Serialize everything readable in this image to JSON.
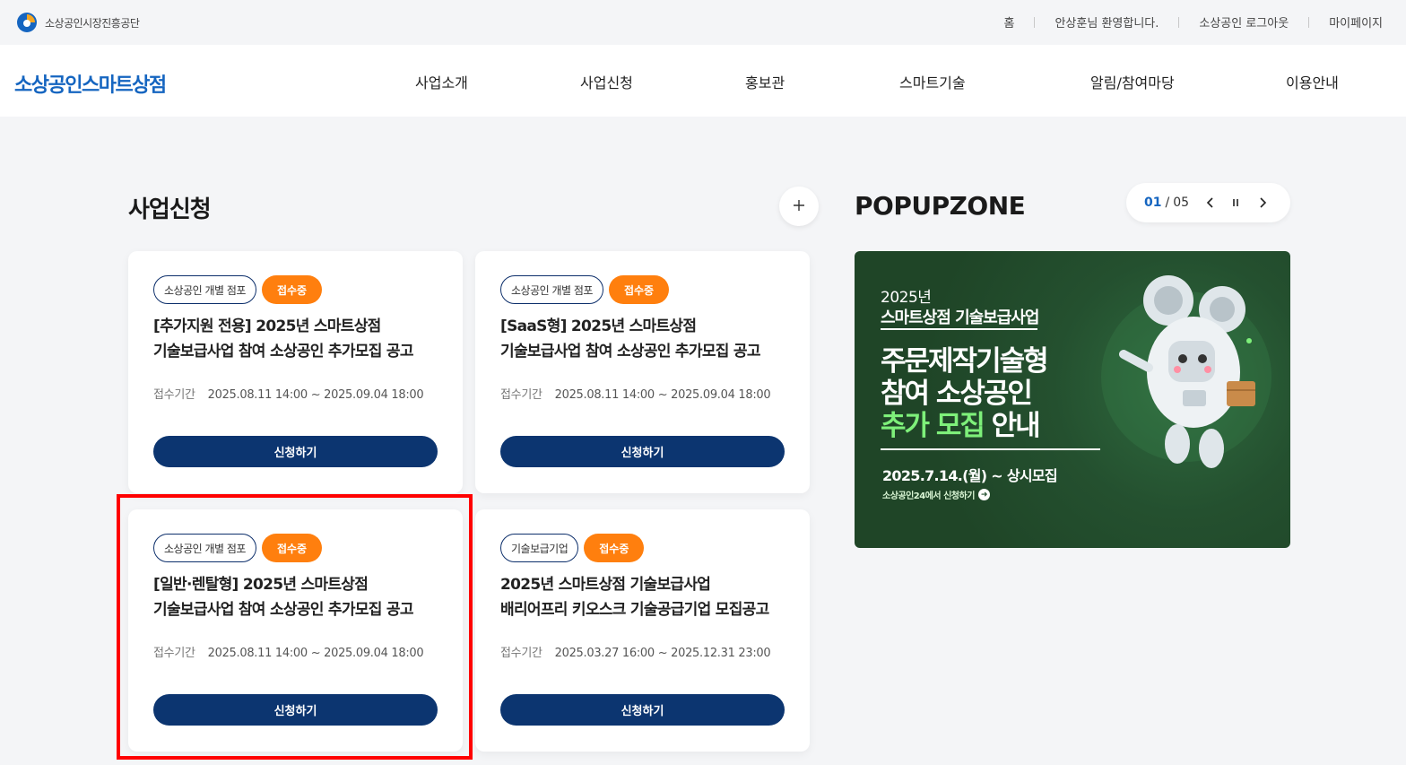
{
  "topbar": {
    "org_name": "소상공인시장진흥공단",
    "links": [
      "홈",
      "안상훈님 환영합니다.",
      "소상공인 로그아웃",
      "마이페이지"
    ]
  },
  "header": {
    "brand": "소상공인스마트상점",
    "nav": [
      "사업소개",
      "사업신청",
      "홍보관",
      "스마트기술",
      "알림/참여마당",
      "이용안내"
    ]
  },
  "section": {
    "title": "사업신청",
    "more_icon": "plus-icon"
  },
  "cards": [
    {
      "category": "소상공인 개별 점포",
      "status": "접수중",
      "title_line1": "[추가지원 전용] 2025년 스마트상점",
      "title_line2": "기술보급사업 참여 소상공인 추가모집 공고",
      "period_label": "접수기간",
      "period": "2025.08.11 14:00 ~ 2025.09.04 18:00",
      "button": "신청하기"
    },
    {
      "category": "소상공인 개별 점포",
      "status": "접수중",
      "title_line1": "[SaaS형] 2025년 스마트상점",
      "title_line2": "기술보급사업 참여 소상공인 추가모집 공고",
      "period_label": "접수기간",
      "period": "2025.08.11 14:00 ~ 2025.09.04 18:00",
      "button": "신청하기"
    },
    {
      "category": "소상공인 개별 점포",
      "status": "접수중",
      "title_line1": "[일반·렌탈형] 2025년 스마트상점",
      "title_line2": "기술보급사업 참여 소상공인 추가모집 공고",
      "period_label": "접수기간",
      "period": "2025.08.11 14:00 ~ 2025.09.04 18:00",
      "button": "신청하기"
    },
    {
      "category": "기술보급기업",
      "status": "접수중",
      "title_line1": "2025년 스마트상점 기술보급사업",
      "title_line2": "배리어프리 키오스크 기술공급기업 모집공고",
      "period_label": "접수기간",
      "period": "2025.03.27 16:00 ~ 2025.12.31 23:00",
      "button": "신청하기"
    }
  ],
  "popupzone": {
    "title": "POPUPZONE",
    "current": "01",
    "separator": "/",
    "total": "05",
    "banner": {
      "year": "2025년",
      "subtitle": "스마트상점 기술보급사업",
      "head_line1": "주문제작기술형",
      "head_line2": "참여 소상공인",
      "head_line3_accent": "추가 모집",
      "head_line3_rest": " 안내",
      "date": "2025.7.14.(월) ~ 상시모집",
      "note": "소상공인24에서 신청하기"
    }
  },
  "colors": {
    "brand_blue": "#1565c0",
    "navy_button": "#0c3570",
    "status_orange": "#ff7f0e",
    "banner_green": "#24502f",
    "highlight_red": "#ff0000"
  }
}
